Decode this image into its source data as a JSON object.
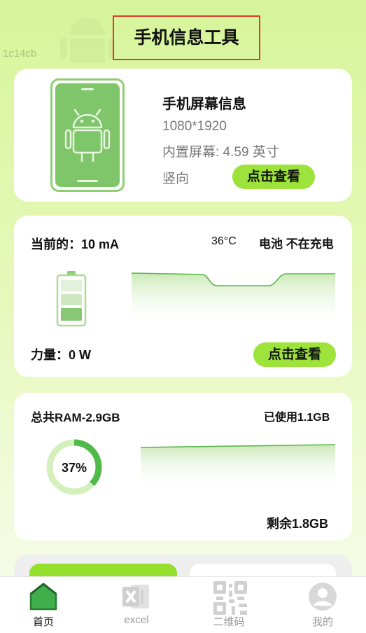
{
  "header": {
    "title": "手机信息工具",
    "tag": "1c14cb"
  },
  "screen_card": {
    "title": "手机屏幕信息",
    "resolution": "1080*1920",
    "size": "内置屏幕: 4.59 英寸",
    "orientation": "竖向",
    "button": "点击查看"
  },
  "battery_card": {
    "current": "当前的：10 mA",
    "temperature": "36°C",
    "status": "电池 不在充电",
    "power": "力量：0 W",
    "button": "点击查看"
  },
  "ram_card": {
    "total": "总共RAM-2.9GB",
    "used": "已使用1.1GB",
    "percent_label": "37%",
    "percent": 37,
    "remaining": "剩余1.8GB"
  },
  "nav": [
    {
      "label": "首页",
      "icon": "home-icon",
      "active": true
    },
    {
      "label": "excel",
      "icon": "excel-icon",
      "active": false
    },
    {
      "label": "二维码",
      "icon": "qr-code-icon",
      "active": false
    },
    {
      "label": "我的",
      "icon": "user-icon",
      "active": false
    }
  ],
  "colors": {
    "accent": "#9de33b",
    "green": "#5cb85c",
    "highlight": "#e23b30"
  }
}
